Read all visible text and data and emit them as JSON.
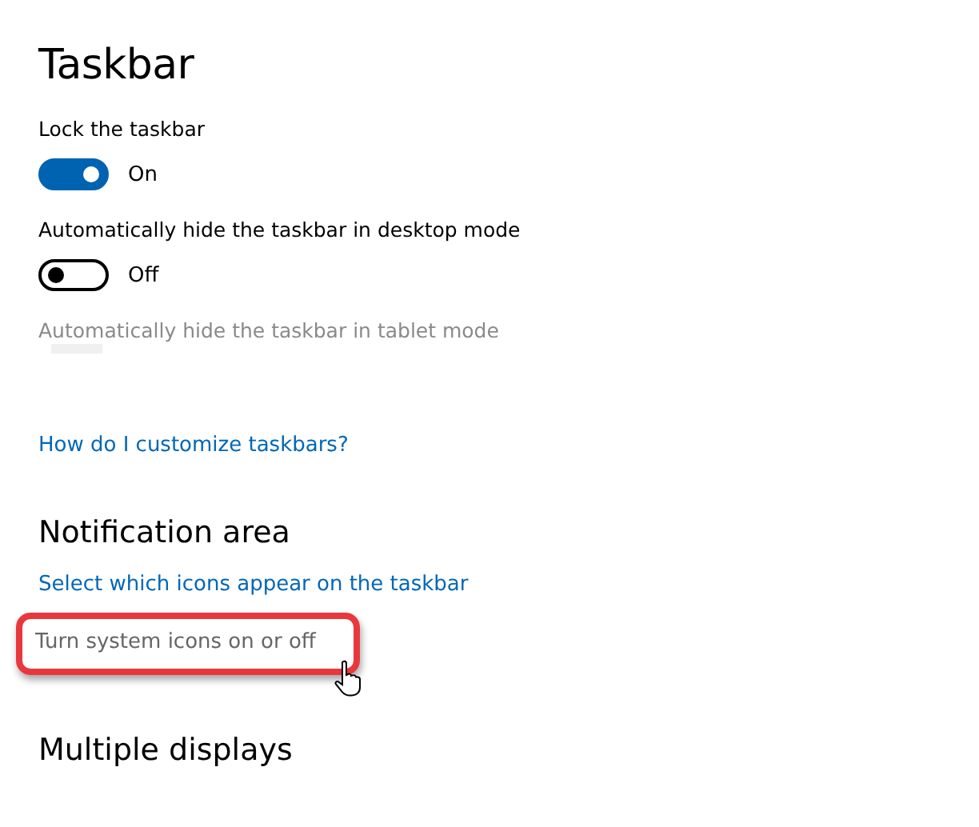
{
  "title": "Taskbar",
  "settings": [
    {
      "label": "Lock the taskbar",
      "disabled": false,
      "on": true,
      "state_text": "On"
    },
    {
      "label": "Automatically hide the taskbar in desktop mode",
      "disabled": false,
      "on": false,
      "state_text": "Off"
    },
    {
      "label": "Automatically hide the taskbar in tablet mode",
      "disabled": true
    }
  ],
  "help_link": "How do I customize taskbars?",
  "sections": [
    {
      "heading": "Notification area",
      "links": [
        {
          "text": "Select which icons appear on the taskbar",
          "kind": "link",
          "highlighted": false
        },
        {
          "text": "Turn system icons on or off",
          "kind": "plain",
          "highlighted": true
        }
      ]
    },
    {
      "heading": "Multiple displays"
    }
  ]
}
